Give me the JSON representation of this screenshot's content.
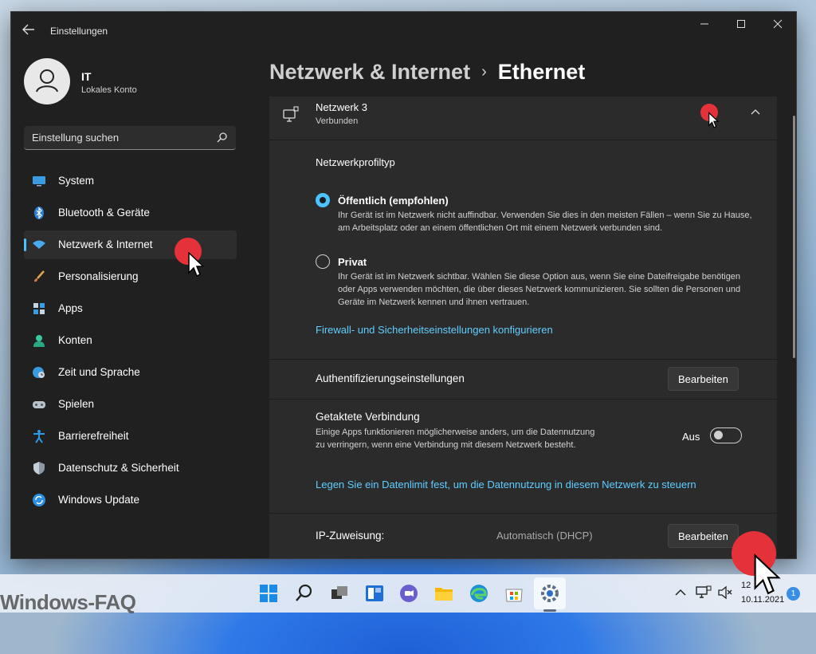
{
  "window": {
    "title": "Einstellungen",
    "controls": [
      "minimize",
      "maximize",
      "close"
    ]
  },
  "user": {
    "name": "IT",
    "account_type": "Lokales Konto"
  },
  "search": {
    "placeholder": "Einstellung suchen"
  },
  "nav": {
    "items": [
      {
        "label": "System",
        "icon": "monitor-icon",
        "active": false
      },
      {
        "label": "Bluetooth & Geräte",
        "icon": "bluetooth-icon",
        "active": false
      },
      {
        "label": "Netzwerk & Internet",
        "icon": "wifi-icon",
        "active": true
      },
      {
        "label": "Personalisierung",
        "icon": "brush-icon",
        "active": false
      },
      {
        "label": "Apps",
        "icon": "apps-icon",
        "active": false
      },
      {
        "label": "Konten",
        "icon": "person-icon",
        "active": false
      },
      {
        "label": "Zeit und Sprache",
        "icon": "clock-globe-icon",
        "active": false
      },
      {
        "label": "Spielen",
        "icon": "gamepad-icon",
        "active": false
      },
      {
        "label": "Barrierefreiheit",
        "icon": "accessibility-icon",
        "active": false
      },
      {
        "label": "Datenschutz & Sicherheit",
        "icon": "shield-icon",
        "active": false
      },
      {
        "label": "Windows Update",
        "icon": "update-icon",
        "active": false
      }
    ]
  },
  "breadcrumb": {
    "parent": "Netzwerk & Internet",
    "separator": "›",
    "current": "Ethernet"
  },
  "network": {
    "name": "Netzwerk 3",
    "status": "Verbunden"
  },
  "profile": {
    "heading": "Netzwerkprofiltyp",
    "options": [
      {
        "title": "Öffentlich (empfohlen)",
        "selected": true,
        "desc": "Ihr Gerät ist im Netzwerk nicht auffindbar. Verwenden Sie dies in den meisten Fällen – wenn Sie zu Hause, am Arbeitsplatz oder an einem öffentlichen Ort mit einem Netzwerk verbunden sind."
      },
      {
        "title": "Privat",
        "selected": false,
        "desc": "Ihr Gerät ist im Netzwerk sichtbar. Wählen Sie diese Option aus, wenn Sie eine Dateifreigabe benötigen oder Apps verwenden möchten, die über dieses Netzwerk kommunizieren. Sie sollten die Personen und Geräte im Netzwerk kennen und ihnen vertrauen."
      }
    ],
    "firewall_link": "Firewall- und Sicherheitseinstellungen konfigurieren"
  },
  "auth": {
    "label": "Authentifizierungseinstellungen",
    "button": "Bearbeiten"
  },
  "metered": {
    "title": "Getaktete Verbindung",
    "desc": "Einige Apps funktionieren möglicherweise anders, um die Datennutzung zu verringern, wenn eine Verbindung mit diesem Netzwerk besteht.",
    "state": "Aus",
    "on": false,
    "link": "Legen Sie ein Datenlimit fest, um die Datennutzung in diesem Netzwerk zu steuern"
  },
  "ip": {
    "label": "IP-Zuweisung:",
    "value": "Automatisch (DHCP)",
    "button": "Bearbeiten"
  },
  "taskbar": {
    "time": "12",
    "date": "10.11.2021",
    "notifications": "1",
    "apps": [
      "windows-start-icon",
      "search-icon",
      "task-view-icon",
      "widgets-icon",
      "teams-chat-icon",
      "file-explorer-icon",
      "edge-icon",
      "store-icon",
      "settings-icon"
    ]
  },
  "watermark": "Windows-FAQ",
  "colors": {
    "accent": "#4cc2ff",
    "link": "#60cdff",
    "click_marker": "#e5323a",
    "window_bg": "#202020",
    "card_bg": "#2b2b2b"
  }
}
